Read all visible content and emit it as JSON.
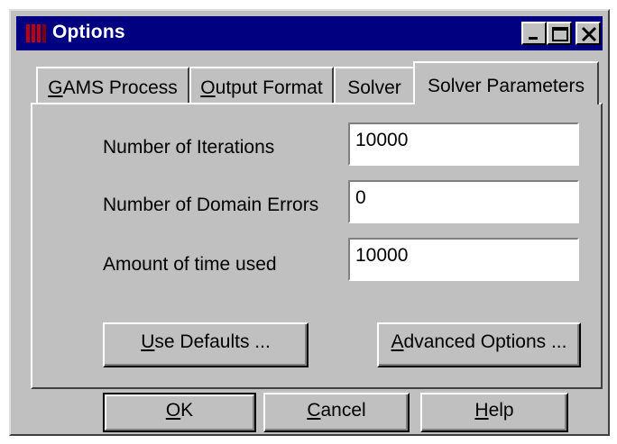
{
  "window": {
    "title": "Options",
    "controls": {
      "minimize_icon": "minimize-icon",
      "maximize_icon": "maximize-icon",
      "close_icon": "close-icon"
    }
  },
  "tabs": [
    {
      "accel": "G",
      "rest": "AMS Process",
      "active": false
    },
    {
      "accel": "O",
      "rest": "utput Format",
      "active": false
    },
    {
      "accel": "",
      "rest": "Solver",
      "active": false
    },
    {
      "accel": "",
      "rest": "Solver Parameters",
      "active": true
    }
  ],
  "fields": [
    {
      "label": "Number of Iterations",
      "value": "10000"
    },
    {
      "label": "Number of Domain Errors",
      "value": "0"
    },
    {
      "label": "Amount of time used",
      "value": "10000"
    }
  ],
  "panel_buttons": {
    "defaults": {
      "accel": "U",
      "rest": "se Defaults ..."
    },
    "advanced": {
      "accel": "A",
      "rest": "dvanced Options ..."
    }
  },
  "dialog_buttons": {
    "ok": {
      "accel": "O",
      "rest": "K"
    },
    "cancel": {
      "accel": "C",
      "rest": "ancel"
    },
    "help": {
      "accel": "H",
      "rest": "elp"
    }
  },
  "colors": {
    "face": "#c0c0c0",
    "titlebar": "#000080",
    "field_bg": "#ffffff"
  }
}
